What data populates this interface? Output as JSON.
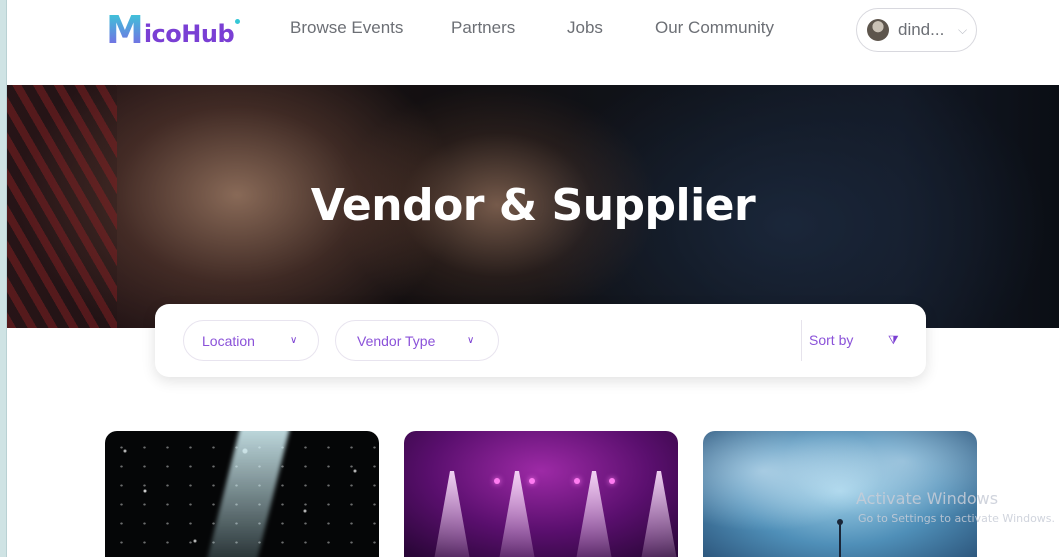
{
  "brand": {
    "logo_text_m": "M",
    "logo_text_rest": "icoHub",
    "logo_primary_color": "#7a3fd4",
    "logo_accent_color": "#35d3d6"
  },
  "nav": {
    "items": [
      {
        "label": "Browse Events"
      },
      {
        "label": "Partners"
      },
      {
        "label": "Jobs"
      },
      {
        "label": "Our Community"
      }
    ]
  },
  "user": {
    "name": "dind...",
    "avatar_icon": "user-avatar"
  },
  "hero": {
    "title": "Vendor & Supplier"
  },
  "filters": {
    "location_label": "Location",
    "vendor_type_label": "Vendor Type",
    "sort_label": "Sort by",
    "accent_color": "#8b52d9"
  },
  "cards": [
    {
      "theme": "starry-stage"
    },
    {
      "theme": "purple-concert-lights"
    },
    {
      "theme": "blue-haze-stage"
    }
  ],
  "watermark": {
    "title": "Activate Windows",
    "subtitle": "Go to Settings to activate Windows."
  }
}
